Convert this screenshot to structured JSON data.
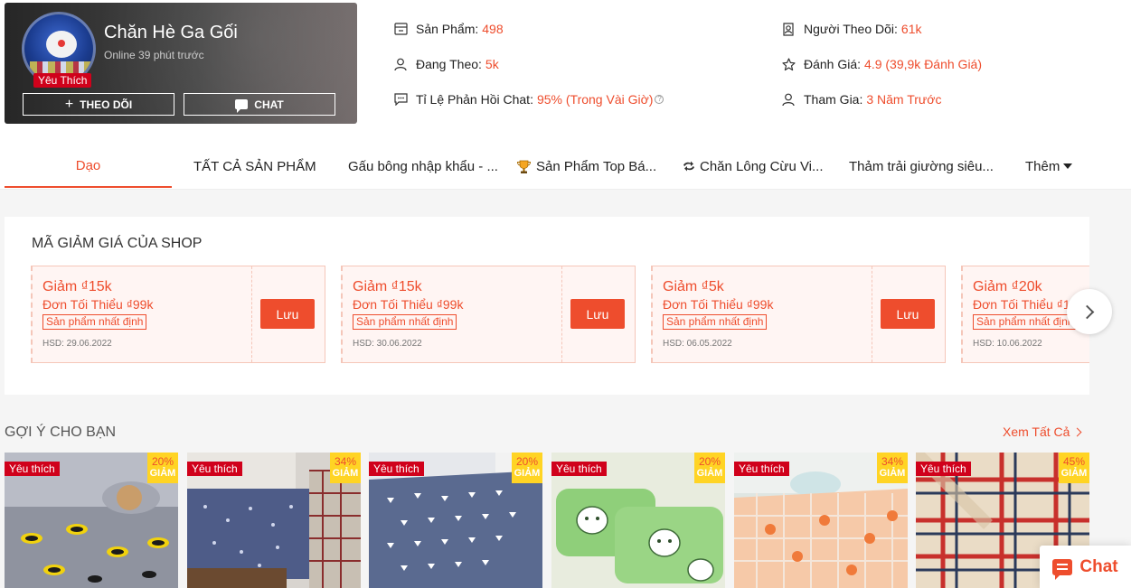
{
  "shop": {
    "name": "Chăn Hè Ga Gối",
    "online": "Online 39 phút trước",
    "badge": "Yêu Thích",
    "follow_label": "THEO DÕI",
    "chat_label": "CHAT"
  },
  "stats": {
    "products_label": "Sản Phẩm:",
    "products_value": "498",
    "following_label": "Đang Theo:",
    "following_value": "5k",
    "response_label": "Tỉ Lệ Phản Hồi Chat:",
    "response_value": "95% (Trong Vài Giờ)",
    "followers_label": "Người Theo Dõi:",
    "followers_value": "61k",
    "rating_label": "Đánh Giá:",
    "rating_value": "4.9 (39,9k Đánh Giá)",
    "joined_label": "Tham Gia:",
    "joined_value": "3 Năm Trước"
  },
  "tabs": [
    {
      "label": "Dạo"
    },
    {
      "label": "TẤT CẢ SẢN PHẨM"
    },
    {
      "label": "Gấu bông nhập khẩu - ..."
    },
    {
      "label": "Sản Phẩm Top Bá..."
    },
    {
      "label": "Chăn Lông Cừu Vi..."
    },
    {
      "label": "Thảm trải giường siêu..."
    },
    {
      "label": "Thêm"
    }
  ],
  "vouchers": {
    "title": "MÃ GIẢM GIÁ CỦA SHOP",
    "save_label": "Lưu",
    "items": [
      {
        "amount": "Giảm ₫15k",
        "min": "Đơn Tối Thiểu ₫99k",
        "tag": "Sản phẩm nhất định",
        "hsd": "HSD: 29.06.2022"
      },
      {
        "amount": "Giảm ₫15k",
        "min": "Đơn Tối Thiểu ₫99k",
        "tag": "Sản phẩm nhất định",
        "hsd": "HSD: 30.06.2022"
      },
      {
        "amount": "Giảm ₫5k",
        "min": "Đơn Tối Thiểu ₫99k",
        "tag": "Sản phẩm nhất định",
        "hsd": "HSD: 06.05.2022"
      },
      {
        "amount": "Giảm ₫20k",
        "min": "Đơn Tối Thiểu ₫1",
        "tag": "Sản phẩm nhất định",
        "hsd": "HSD: 10.06.2022"
      }
    ]
  },
  "suggestions": {
    "title": "GỢI Ý CHO BẠN",
    "see_all": "Xem Tất Cả",
    "products": [
      {
        "fav": "Yêu thích",
        "pct": "20%",
        "disc": "GIẢM"
      },
      {
        "fav": "Yêu thích",
        "pct": "34%",
        "disc": "GIẢM"
      },
      {
        "fav": "Yêu thích",
        "pct": "20%",
        "disc": "GIẢM"
      },
      {
        "fav": "Yêu thích",
        "pct": "20%",
        "disc": "GIẢM"
      },
      {
        "fav": "Yêu thích",
        "pct": "34%",
        "disc": "GIẢM"
      },
      {
        "fav": "Yêu thích",
        "pct": "45%",
        "disc": "GIẢM"
      }
    ]
  },
  "float_chat": {
    "label": "Chat"
  },
  "colors": {
    "accent": "#ee4d2d",
    "badge": "#d0011b",
    "discount": "#ffd424"
  }
}
